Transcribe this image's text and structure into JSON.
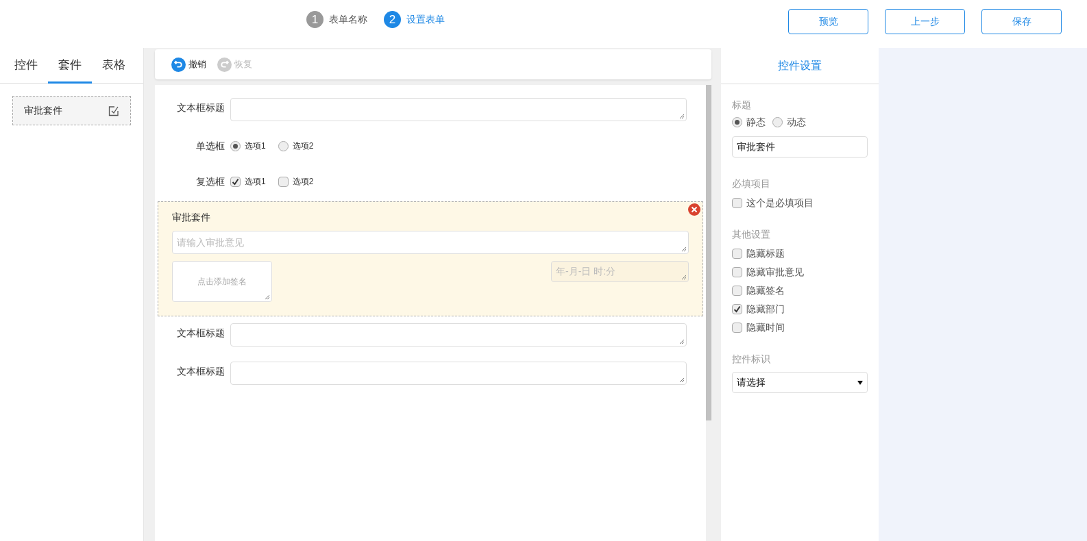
{
  "steps": [
    {
      "number": "1",
      "label": "表单名称",
      "selected": false
    },
    {
      "number": "2",
      "label": "设置表单",
      "selected": true
    }
  ],
  "buttons": [
    "预览",
    "上一步",
    "保存"
  ],
  "tabs": [
    {
      "label": "控件",
      "selected": false
    },
    {
      "label": "套件",
      "selected": true
    },
    {
      "label": "表格",
      "selected": false
    }
  ],
  "kits": [
    {
      "label": "审批套件"
    }
  ],
  "toolbar": [
    {
      "kind": "undo",
      "label": "撤销",
      "disabled": false
    },
    {
      "kind": "redo",
      "label": "恢复",
      "disabled": true
    }
  ],
  "form": [
    {
      "kind": "textarea",
      "label": "文本框标题"
    },
    {
      "kind": "radio",
      "label": "单选框",
      "options": [
        {
          "label": "选项1",
          "checked": true
        },
        {
          "label": "选项2",
          "checked": false
        }
      ]
    },
    {
      "kind": "checkbox",
      "label": "复选框",
      "options": [
        {
          "label": "选项1",
          "checked": true
        },
        {
          "label": "选项2",
          "checked": false
        }
      ]
    },
    {
      "kind": "kit",
      "label": "审批套件",
      "opinion_placeholder": "请输入审批意见",
      "signature": "点击添加签名",
      "time_placeholder": "年-月-日 时:分"
    },
    {
      "kind": "textarea",
      "label": "文本框标题"
    },
    {
      "kind": "textarea",
      "label": "文本框标题"
    }
  ],
  "settings": {
    "title": "控件设置",
    "title_section": {
      "label": "标题",
      "modes": [
        {
          "label": "静态",
          "selected": true
        },
        {
          "label": "动态",
          "selected": false
        }
      ],
      "value": "审批套件"
    },
    "required_section": {
      "label": "必填项目",
      "options": [
        {
          "label": "这个是必填项目",
          "checked": false
        }
      ]
    },
    "other_section": {
      "label": "其他设置",
      "options": [
        {
          "label": "隐藏标题",
          "checked": false
        },
        {
          "label": "隐藏审批意见",
          "checked": false
        },
        {
          "label": "隐藏签名",
          "checked": false
        },
        {
          "label": "隐藏部门",
          "checked": true
        },
        {
          "label": "隐藏时间",
          "checked": false
        }
      ]
    },
    "id_section": {
      "label": "控件标识",
      "value": "请选择"
    }
  }
}
